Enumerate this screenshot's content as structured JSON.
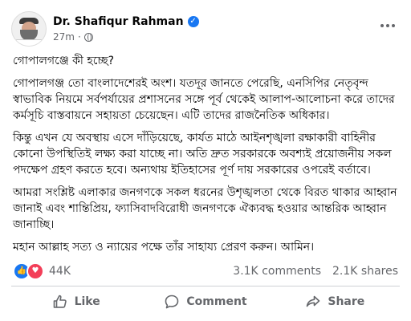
{
  "post": {
    "author": "Dr. Shafiqur Rahman",
    "verified_icon": "verified-badge-icon",
    "time": "27m",
    "audience_icon": "globe-icon",
    "more_icon": "more-options-icon",
    "paragraphs": [
      "গোপালগঞ্জে কী হচ্ছে?",
      "গোপালগঞ্জ তো বাংলাদেশেরই অংশ। যতদূর জানতে পেরেছি, এনসিপির নেতৃবৃন্দ স্বাভাবিক নিয়মে সর্বপর্যায়ের প্রশাসনের সঙ্গে পূর্ব থেকেই আলাপ-আলোচনা করে তাদের কর্মসূচি বাস্তবায়নে সহায়তা চেয়েছেন। এটি তাদের রাজনৈতিক অধিকার।",
      "কিন্তু এখন যে অবস্থায় এসে দাঁড়িয়েছে, কার্যত মাঠে আইনশৃঙ্খলা রক্ষাকারী বাহিনীর কোনো উপস্থিতিই লক্ষ্য করা যাচ্ছে না। অতি দ্রুত সরকারকে অবশ্যই প্রয়োজনীয় সকল পদক্ষেপ গ্রহণ করতে হবে। অন্যথায় ইতিহাসের পূর্ণ দায় সরকারের ওপরেই বর্তাবে।",
      "আমরা সংশ্লিষ্ট এলাকার জনগণকে সকল ধরনের উশৃঙ্খলতা থেকে বিরত থাকার আহ্বান জানাই এবং শান্তিপ্রিয়, ফ্যাসিবাদবিরোধী জনগণকে ঐক্যবদ্ধ হওয়ার আন্তরিক আহ্বান জানাচ্ছি।",
      "মহান আল্লাহ সত্য ও ন্যায়ের পক্ষে তাঁর সাহায্য প্রেরণ করুন। আমিন।"
    ]
  },
  "engagement": {
    "reaction_icons": [
      "like-reaction-icon",
      "love-reaction-icon"
    ],
    "reaction_count": "44K",
    "comments": "3.1K comments",
    "shares": "2.1K shares"
  },
  "actions": {
    "like": "Like",
    "comment": "Comment",
    "share": "Share"
  },
  "colors": {
    "brand_blue": "#1877f2",
    "love_red": "#f33e58",
    "secondary_text": "#65676b",
    "primary_text": "#050505"
  }
}
